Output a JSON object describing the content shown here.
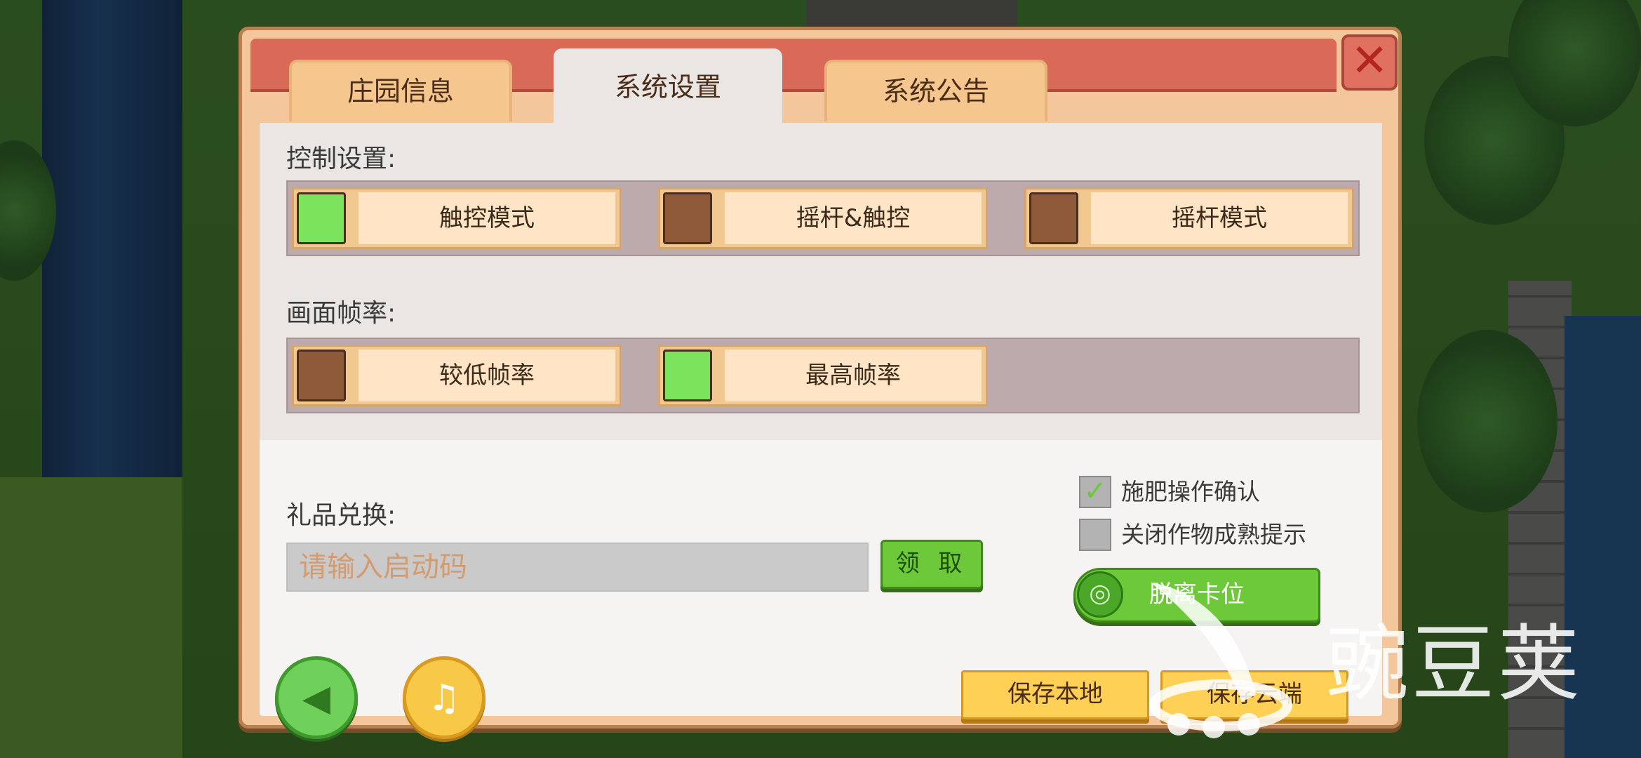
{
  "tabs": [
    {
      "label": "庄园信息",
      "active": false
    },
    {
      "label": "系统设置",
      "active": true
    },
    {
      "label": "系统公告",
      "active": false
    }
  ],
  "close_icon": "close-icon",
  "control": {
    "label": "控制设置:",
    "options": [
      {
        "label": "触控模式",
        "selected": true
      },
      {
        "label": "摇杆&触控",
        "selected": false
      },
      {
        "label": "摇杆模式",
        "selected": false
      }
    ]
  },
  "framerate": {
    "label": "画面帧率:",
    "options": [
      {
        "label": "较低帧率",
        "selected": false
      },
      {
        "label": "最高帧率",
        "selected": true
      }
    ]
  },
  "gift": {
    "label": "礼品兑换:",
    "placeholder": "请输入启动码",
    "claim_label": "领 取"
  },
  "checkboxes": [
    {
      "label": "施肥操作确认",
      "checked": true
    },
    {
      "label": "关闭作物成熟提示",
      "checked": false
    }
  ],
  "unstuck_label": "脱离卡位",
  "footer": {
    "sound_icon": "speaker-icon",
    "music_icon": "music-note-icon",
    "save_local": "保存本地",
    "save_cloud": "保存云端"
  },
  "watermark": {
    "text": "豌豆荚"
  },
  "colors": {
    "selected_green": "#7be35c",
    "unselected_brown": "#8e5a3a",
    "header_red": "#d86a57",
    "button_green": "#6dc93a",
    "button_yellow": "#ffd056"
  }
}
